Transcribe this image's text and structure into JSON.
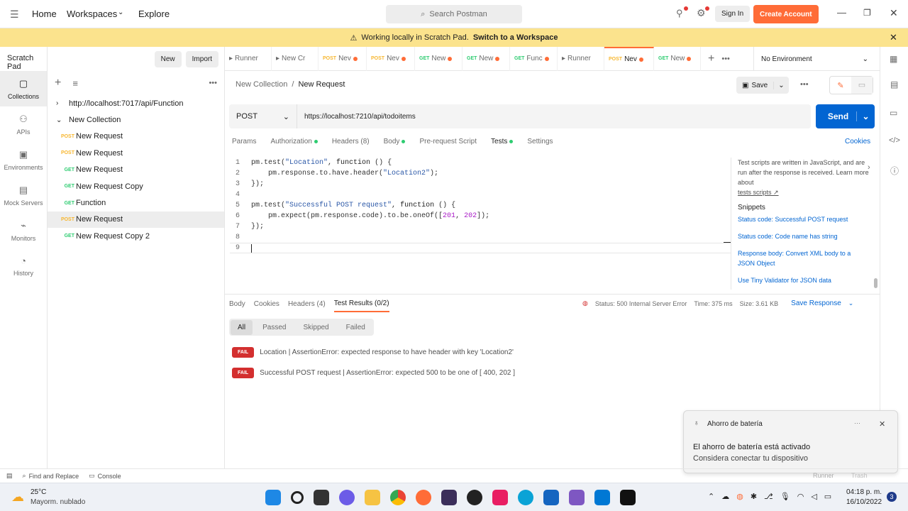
{
  "top": {
    "home": "Home",
    "workspaces": "Workspaces",
    "explore": "Explore",
    "search_placeholder": "Search Postman",
    "sign_in": "Sign In",
    "create_account": "Create Account"
  },
  "banner": {
    "text": "Working locally in Scratch Pad.",
    "link": "Switch to a Workspace"
  },
  "sidebar": {
    "title": "Scratch Pad",
    "new": "New",
    "import": "Import",
    "rail": [
      {
        "label": "Collections",
        "icon": "collections-icon"
      },
      {
        "label": "APIs",
        "icon": "apis-icon"
      },
      {
        "label": "Environments",
        "icon": "environments-icon"
      },
      {
        "label": "Mock Servers",
        "icon": "mock-servers-icon"
      },
      {
        "label": "Monitors",
        "icon": "monitors-icon"
      },
      {
        "label": "History",
        "icon": "history-icon"
      }
    ],
    "tree": [
      {
        "label": "http://localhost:7017/api/Function"
      },
      {
        "label": "New Collection"
      },
      {
        "method": "POST",
        "label": "New Request"
      },
      {
        "method": "POST",
        "label": "New Request"
      },
      {
        "method": "GET",
        "label": "New Request"
      },
      {
        "method": "GET",
        "label": "New Request Copy"
      },
      {
        "method": "GET",
        "label": "Function"
      },
      {
        "method": "POST",
        "label": "New Request"
      },
      {
        "method": "GET",
        "label": "New Request Copy 2"
      }
    ]
  },
  "tabs": [
    {
      "label": "Runner"
    },
    {
      "label": "New Cr"
    },
    {
      "method": "POST",
      "label": "Nev"
    },
    {
      "method": "POST",
      "label": "Nev"
    },
    {
      "method": "GET",
      "label": "New"
    },
    {
      "method": "GET",
      "label": "New"
    },
    {
      "method": "GET",
      "label": "Func"
    },
    {
      "label": "Runner"
    },
    {
      "method": "POST",
      "label": "Nev"
    },
    {
      "method": "GET",
      "label": "New"
    }
  ],
  "environment": "No Environment",
  "request": {
    "breadcrumb_parent": "New Collection",
    "breadcrumb_sep": "/",
    "breadcrumb_current": "New Request",
    "save": "Save",
    "method": "POST",
    "url": "https://localhost:7210/api/todoitems",
    "send": "Send",
    "tabs": [
      "Params",
      "Authorization",
      "Headers (8)",
      "Body",
      "Pre-request Script",
      "Tests",
      "Settings"
    ],
    "cookies": "Cookies"
  },
  "editor": {
    "lines": [
      {
        "n": "1",
        "t": "pm.test(\"Location\", function () {"
      },
      {
        "n": "2",
        "t": "    pm.response.to.have.header(\"Location2\");"
      },
      {
        "n": "3",
        "t": "});"
      },
      {
        "n": "4",
        "t": ""
      },
      {
        "n": "5",
        "t": "pm.test(\"Successful POST request\", function () {"
      },
      {
        "n": "6",
        "t": "    pm.expect(pm.response.code).to.be.oneOf([201, 202]);"
      },
      {
        "n": "7",
        "t": "});"
      },
      {
        "n": "8",
        "t": ""
      },
      {
        "n": "9",
        "t": ""
      }
    ]
  },
  "snippets": {
    "intro": "Test scripts are written in JavaScript, and are run after the response is received. Learn more about",
    "intro_link": "tests scripts ↗",
    "heading": "Snippets",
    "items": [
      "Status code: Successful POST request",
      "Status code: Code name has string",
      "Response body: Convert XML body to a JSON Object",
      "Use Tiny Validator for JSON data"
    ]
  },
  "response": {
    "tabs": [
      "Body",
      "Cookies",
      "Headers (4)",
      "Test Results (0/2)"
    ],
    "status": "Status: 500 Internal Server Error",
    "time": "Time: 375 ms",
    "size": "Size: 3.61 KB",
    "save_response": "Save Response",
    "filters": [
      "All",
      "Passed",
      "Skipped",
      "Failed"
    ],
    "results": [
      {
        "badge": "FAIL",
        "text": "Location | AssertionError: expected response to have header with key 'Location2'"
      },
      {
        "badge": "FAIL",
        "text": "Successful POST request | AssertionError: expected 500 to be one of [ 400, 202 ]"
      }
    ]
  },
  "toast": {
    "app": "Ahorro de batería",
    "title": "El ahorro de batería está activado",
    "body": "Considera conectar tu dispositivo"
  },
  "statusbar": {
    "find": "Find and Replace",
    "console": "Console",
    "runner": "Runner",
    "trash": "Trash"
  },
  "taskbar": {
    "temp": "25°C",
    "weather": "Mayorm. nublado",
    "time": "04:18 p. m.",
    "date": "16/10/2022",
    "badge": "3"
  },
  "colors": {
    "accent": "#ff6c37",
    "send": "#0265d2",
    "banner": "#fbe38d",
    "fail": "#d32f2f"
  }
}
